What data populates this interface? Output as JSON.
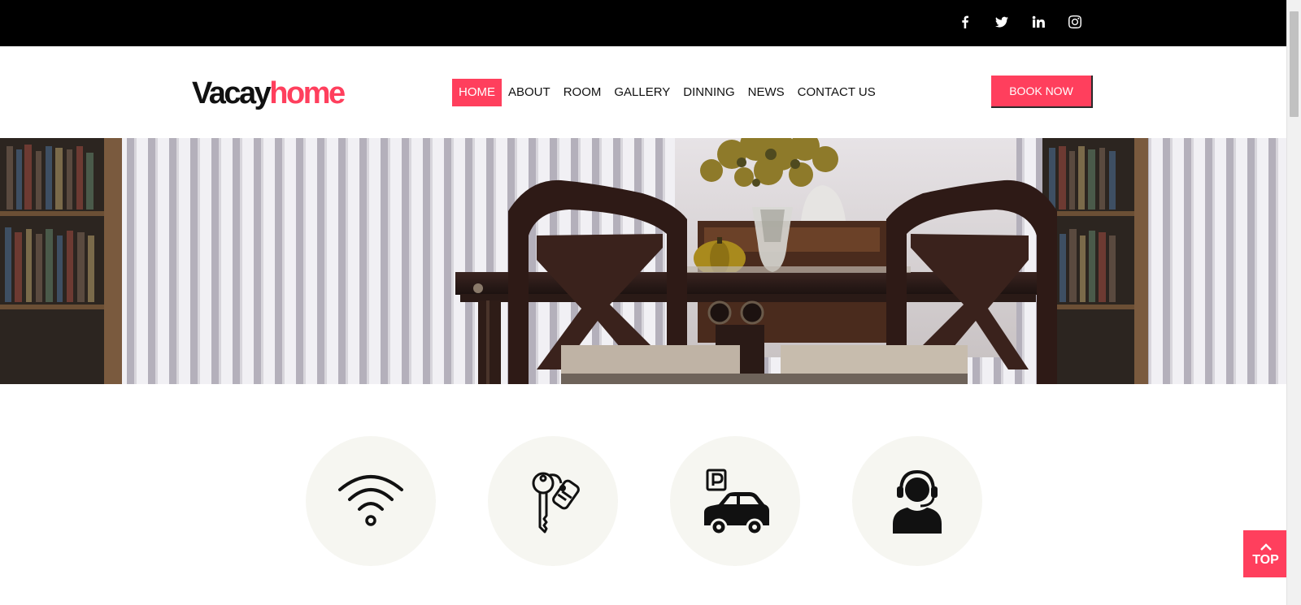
{
  "social": {
    "facebook": "facebook-icon",
    "twitter": "twitter-icon",
    "linkedin": "linkedin-icon",
    "instagram": "instagram-icon"
  },
  "logo": {
    "part1": "Vacay",
    "part2": "home"
  },
  "nav": {
    "items": [
      {
        "label": "HOME",
        "active": true
      },
      {
        "label": "ABOUT"
      },
      {
        "label": "ROOM"
      },
      {
        "label": "GALLERY"
      },
      {
        "label": "DINNING"
      },
      {
        "label": "NEWS"
      },
      {
        "label": "CONTACT US"
      }
    ]
  },
  "cta": {
    "book_label": "BOOK NOW"
  },
  "features": [
    {
      "icon": "wifi-icon"
    },
    {
      "icon": "key-icon"
    },
    {
      "icon": "parking-car-icon"
    },
    {
      "icon": "support-agent-icon"
    }
  ],
  "top_button": {
    "label": "TOP"
  },
  "colors": {
    "accent": "#ff3f5d",
    "topbar": "#000000",
    "feature_bg": "#f6f6f1"
  }
}
